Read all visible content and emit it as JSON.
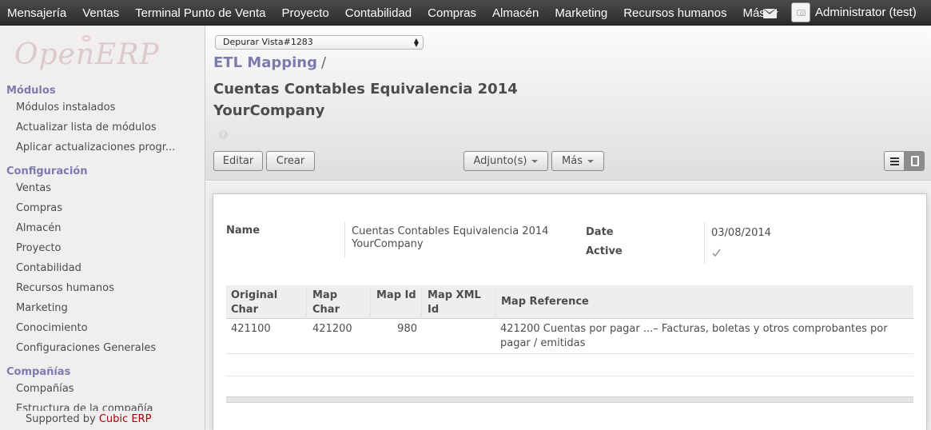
{
  "topbar": {
    "menu": [
      "Mensajería",
      "Ventas",
      "Terminal Punto de Venta",
      "Proyecto",
      "Contabilidad",
      "Compras",
      "Almacén",
      "Marketing",
      "Recursos humanos"
    ],
    "more_label": "Más",
    "user_name": "Administrator (test)",
    "mail_icon": "envelope-icon",
    "avatar_icon": "camera-icon"
  },
  "sidebar": {
    "logo_text": "OpenERP",
    "sections": [
      {
        "title": "Módulos",
        "items": [
          "Módulos instalados",
          "Actualizar lista de módulos",
          "Aplicar actualizaciones progr..."
        ]
      },
      {
        "title": "Configuración",
        "items": [
          "Ventas",
          "Compras",
          "Almacén",
          "Proyecto",
          "Contabilidad",
          "Recursos humanos",
          "Marketing",
          "Conocimiento",
          "Configuraciones Generales"
        ]
      },
      {
        "title": "Compañías",
        "items": [
          "Compañías",
          "Estructura de la compañía"
        ]
      }
    ],
    "footer_prefix": "Supported by",
    "footer_brand": "Cubic ERP"
  },
  "header": {
    "debug_select": "Depurar Vista#1283",
    "breadcrumb": "ETL Mapping",
    "breadcrumb_sep": "/",
    "title_line1": "Cuentas Contables Equivalencia 2014",
    "title_line2": "YourCompany",
    "help": "?",
    "buttons": {
      "edit": "Editar",
      "create": "Crear",
      "attachments": "Adjunto(s)",
      "more": "Más"
    }
  },
  "form": {
    "name_label": "Name",
    "name_value_line1": "Cuentas Contables Equivalencia 2014",
    "name_value_line2": "YourCompany",
    "date_label": "Date",
    "date_value": "03/08/2014",
    "active_label": "Active",
    "active_checked": true
  },
  "table": {
    "headers": {
      "original_char_1": "Original",
      "original_char_2": "Char",
      "map_char": "Map Char",
      "map_id": "Map Id",
      "map_xml_id": "Map XML Id",
      "map_reference": "Map Reference"
    },
    "rows": [
      {
        "original_char": "421100",
        "map_char": "421200",
        "map_id": "980",
        "map_xml_id": "",
        "map_reference_1": "421200 Cuentas por pagar ...– Facturas, boletas y otros comprobantes por",
        "map_reference_2": "pagar / emitidas"
      }
    ]
  }
}
